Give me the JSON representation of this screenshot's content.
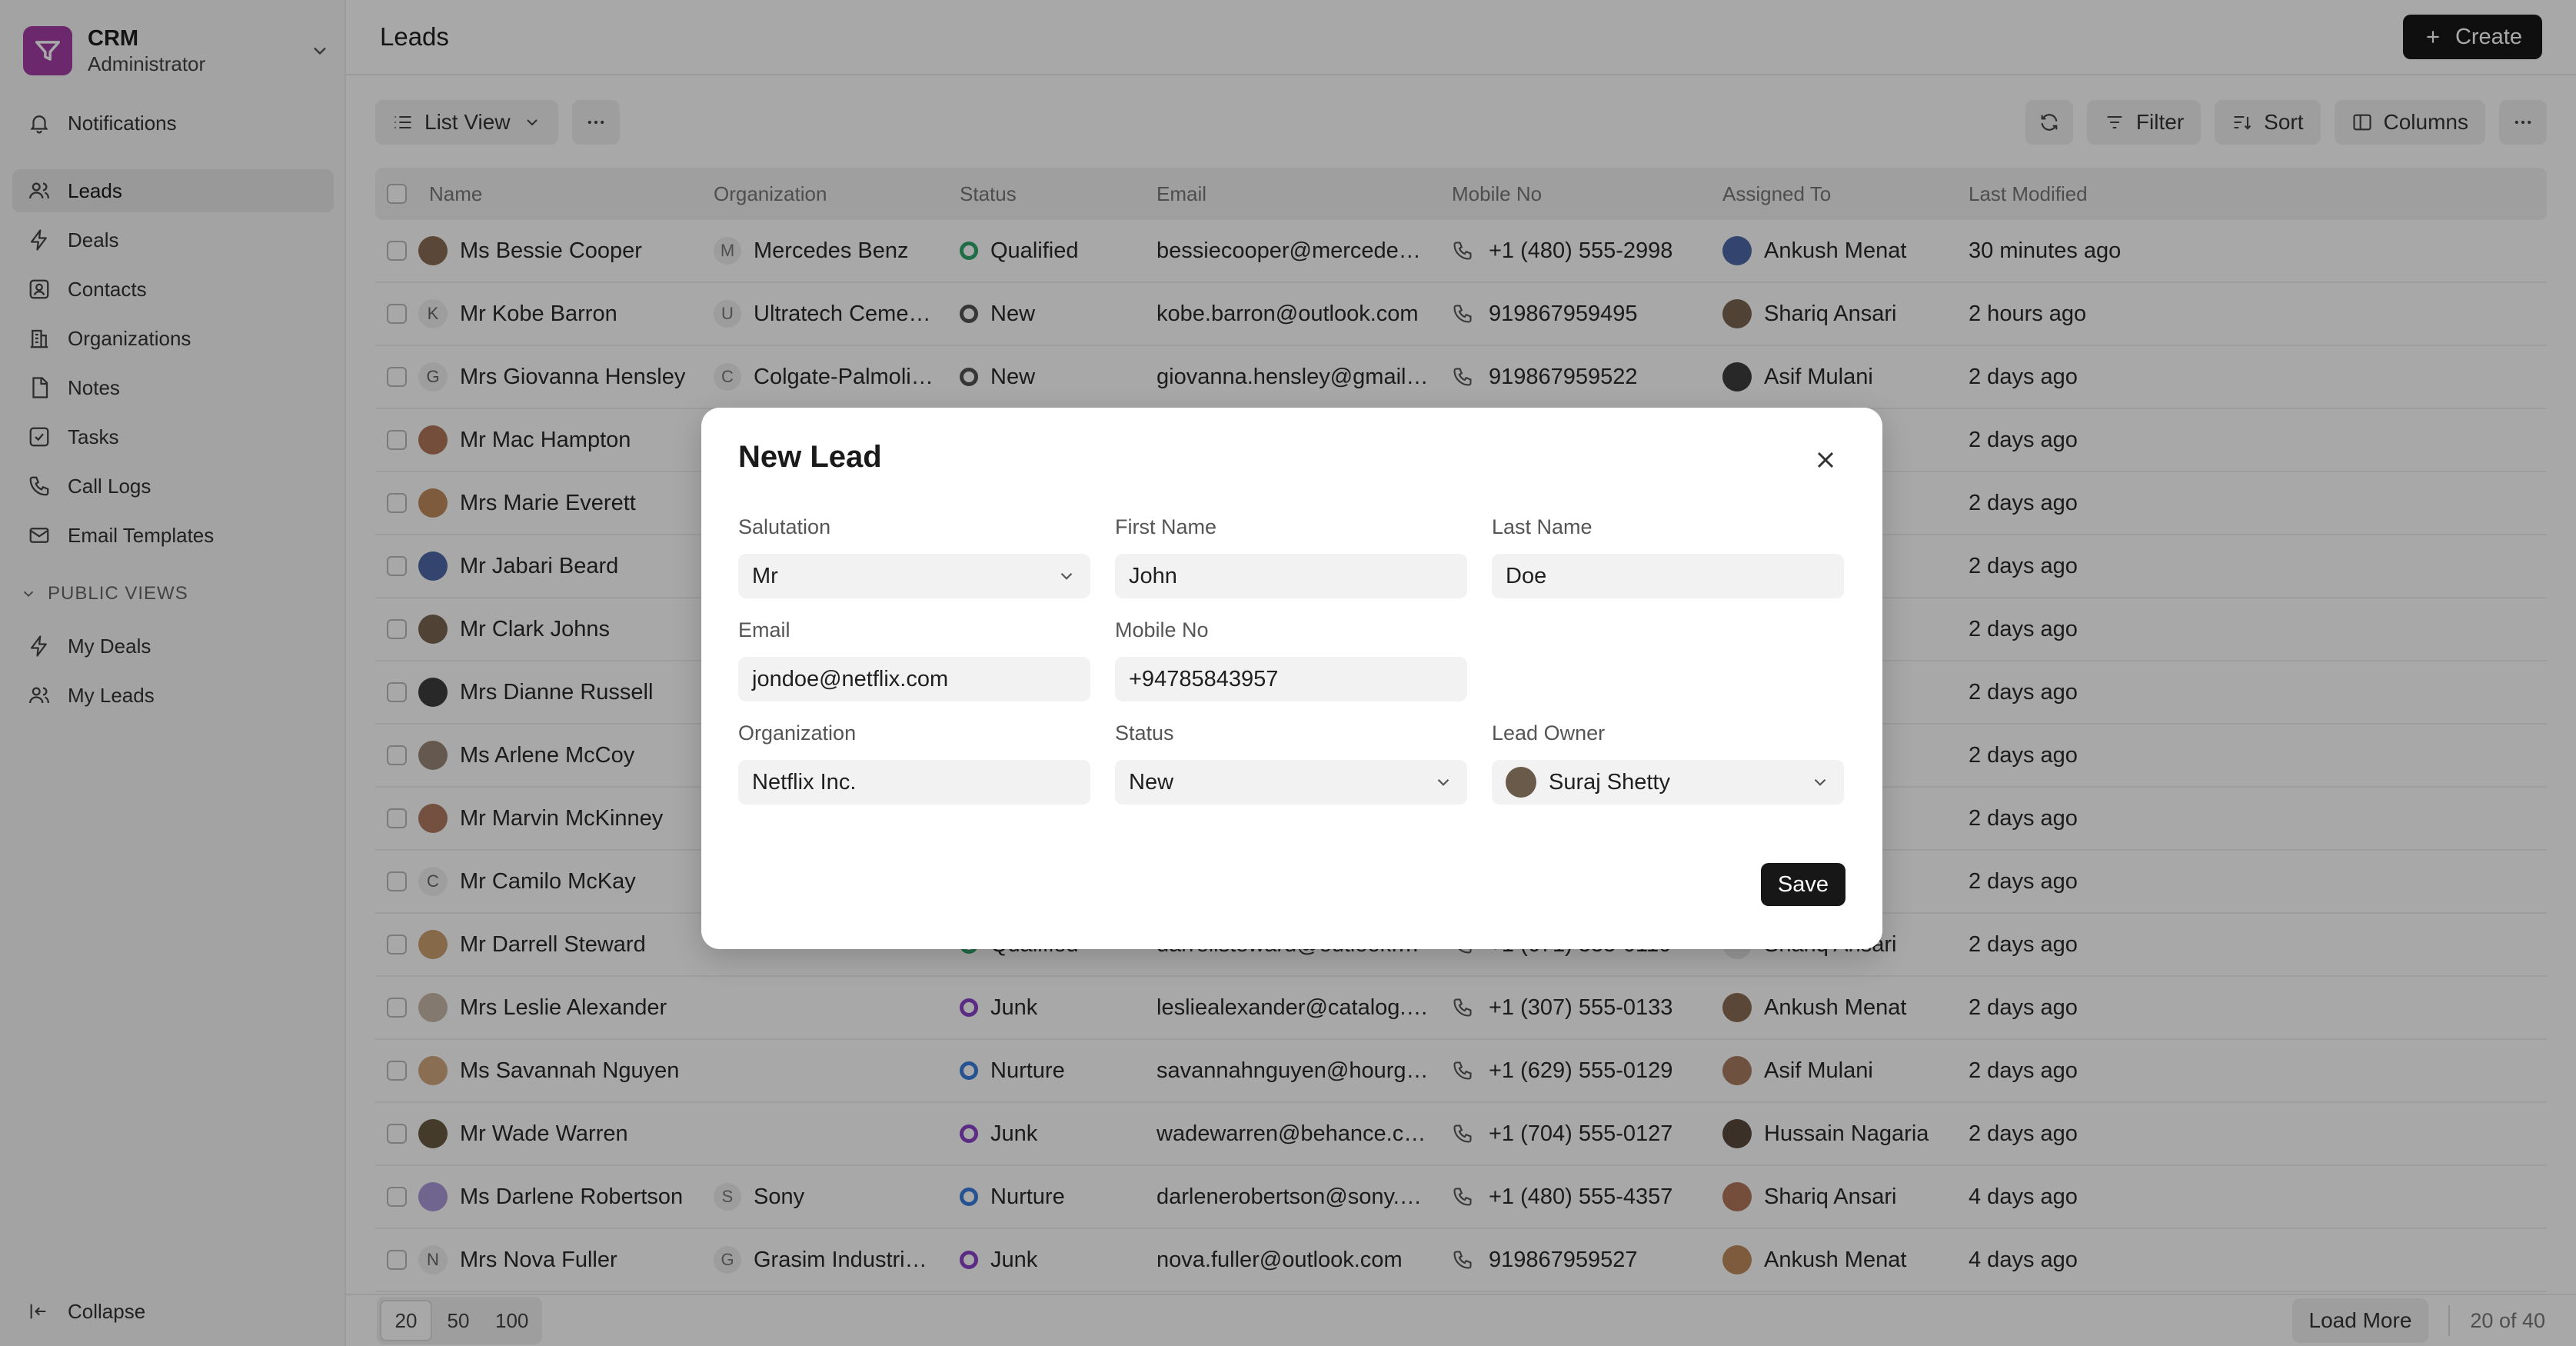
{
  "app": {
    "name": "CRM",
    "role": "Administrator"
  },
  "nav": {
    "items": [
      {
        "label": "Notifications",
        "icon": "bell-icon"
      },
      {
        "label": "Leads",
        "icon": "users-icon",
        "active": true
      },
      {
        "label": "Deals",
        "icon": "zap-icon"
      },
      {
        "label": "Contacts",
        "icon": "contact-icon"
      },
      {
        "label": "Organizations",
        "icon": "building-icon"
      },
      {
        "label": "Notes",
        "icon": "note-icon"
      },
      {
        "label": "Tasks",
        "icon": "checkbox-icon"
      },
      {
        "label": "Call Logs",
        "icon": "phone-icon"
      },
      {
        "label": "Email Templates",
        "icon": "mail-icon"
      }
    ],
    "section_label": "PUBLIC VIEWS",
    "public_views": [
      {
        "label": "My Deals",
        "icon": "zap-icon"
      },
      {
        "label": "My Leads",
        "icon": "users-icon"
      }
    ],
    "collapse_label": "Collapse"
  },
  "header": {
    "title": "Leads",
    "create_label": "Create"
  },
  "toolbar": {
    "view_label": "List View",
    "filter_label": "Filter",
    "sort_label": "Sort",
    "columns_label": "Columns"
  },
  "table": {
    "columns": [
      "Name",
      "Organization",
      "Status",
      "Email",
      "Mobile No",
      "Assigned To",
      "Last Modified"
    ],
    "rows": [
      {
        "name": "Ms Bessie Cooper",
        "org_letter": "M",
        "org": "Mercedes Benz",
        "status": "Qualified",
        "email": "bessiecooper@mercede…",
        "mobile": "+1 (480) 555-2998",
        "assigned": "Ankush Menat",
        "modified": "30 minutes ago"
      },
      {
        "name": "Mr Kobe Barron",
        "name_letter": "K",
        "org_letter": "U",
        "org": "Ultratech Ceme…",
        "status": "New",
        "email": "kobe.barron@outlook.com",
        "mobile": "919867959495",
        "assigned": "Shariq Ansari",
        "modified": "2 hours ago"
      },
      {
        "name": "Mrs Giovanna Hensley",
        "name_letter": "G",
        "org_letter": "C",
        "org": "Colgate-Palmoli…",
        "status": "New",
        "email": "giovanna.hensley@gmail…",
        "mobile": "919867959522",
        "assigned": "Asif Mulani",
        "modified": "2 days ago"
      },
      {
        "name": "Mr Mac Hampton",
        "org": "",
        "status": "",
        "email": "",
        "mobile": "",
        "assigned": "tty",
        "modified": "2 days ago"
      },
      {
        "name": "Mrs Marie Everett",
        "org": "",
        "status": "",
        "email": "",
        "mobile": "",
        "assigned": "ni",
        "modified": "2 days ago"
      },
      {
        "name": "Mr Jabari Beard",
        "org": "",
        "status": "",
        "email": "",
        "mobile": "",
        "assigned": "sari",
        "modified": "2 days ago"
      },
      {
        "name": "Mr Clark Johns",
        "org": "",
        "status": "",
        "email": "",
        "mobile": "",
        "assigned": "enat",
        "modified": "2 days ago"
      },
      {
        "name": "Mrs Dianne Russell",
        "org": "",
        "status": "",
        "email": "",
        "mobile": "",
        "assigned": "ari",
        "modified": "2 days ago"
      },
      {
        "name": "Ms Arlene McCoy",
        "org": "",
        "status": "",
        "email": "",
        "mobile": "",
        "assigned": "sari",
        "modified": "2 days ago"
      },
      {
        "name": "Mr Marvin McKinney",
        "org": "",
        "status": "",
        "email": "",
        "mobile": "",
        "assigned": "tty",
        "modified": "2 days ago"
      },
      {
        "name": "Mr Camilo McKay",
        "name_letter": "C",
        "org": "",
        "status": "",
        "email": "",
        "mobile": "",
        "assigned": "tty",
        "modified": "2 days ago"
      },
      {
        "name": "Mr Darrell Steward",
        "org": "",
        "status": "Qualified",
        "email": "darrellsteward@outlook.…",
        "mobile": "+1 (671) 555-0110",
        "assigned": "Shariq Ansari",
        "modified": "2 days ago"
      },
      {
        "name": "Mrs Leslie Alexander",
        "org": "",
        "status": "Junk",
        "email": "lesliealexander@catalog.…",
        "mobile": "+1 (307) 555-0133",
        "assigned": "Ankush Menat",
        "modified": "2 days ago"
      },
      {
        "name": "Ms Savannah Nguyen",
        "org": "",
        "status": "Nurture",
        "email": "savannahnguyen@hourg…",
        "mobile": "+1 (629) 555-0129",
        "assigned": "Asif Mulani",
        "modified": "2 days ago"
      },
      {
        "name": "Mr Wade Warren",
        "org": "",
        "status": "Junk",
        "email": "wadewarren@behance.c…",
        "mobile": "+1 (704) 555-0127",
        "assigned": "Hussain Nagaria",
        "modified": "2 days ago"
      },
      {
        "name": "Ms Darlene Robertson",
        "org_letter": "S",
        "org": "Sony",
        "status": "Nurture",
        "email": "darlenerobertson@sony.…",
        "mobile": "+1 (480) 555-4357",
        "assigned": "Shariq Ansari",
        "modified": "4 days ago"
      },
      {
        "name": "Mrs Nova Fuller",
        "name_letter": "N",
        "org_letter": "G",
        "org": "Grasim Industri…",
        "status": "Junk",
        "email": "nova.fuller@outlook.com",
        "mobile": "919867959527",
        "assigned": "Ankush Menat",
        "modified": "4 days ago"
      }
    ]
  },
  "status_colors": {
    "Qualified": "#30a66d",
    "New": "#525252",
    "Junk": "#8b44c7",
    "Nurture": "#3b7ddd"
  },
  "footer": {
    "page_sizes": [
      "20",
      "50",
      "100"
    ],
    "load_more_label": "Load More",
    "count_label": "20 of 40"
  },
  "modal": {
    "title": "New Lead",
    "fields": {
      "salutation": {
        "label": "Salutation",
        "value": "Mr"
      },
      "first_name": {
        "label": "First Name",
        "value": "John"
      },
      "last_name": {
        "label": "Last Name",
        "value": "Doe"
      },
      "email": {
        "label": "Email",
        "value": "jondoe@netflix.com"
      },
      "mobile": {
        "label": "Mobile No",
        "value": "+94785843957"
      },
      "organization": {
        "label": "Organization",
        "value": "Netflix Inc."
      },
      "status": {
        "label": "Status",
        "value": "New"
      },
      "lead_owner": {
        "label": "Lead Owner",
        "value": "Suraj Shetty"
      }
    },
    "save_label": "Save"
  }
}
